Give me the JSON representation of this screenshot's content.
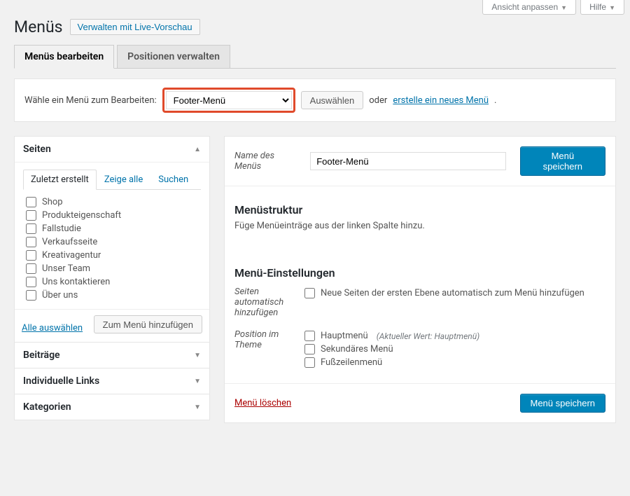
{
  "screen_meta": {
    "customize": "Ansicht anpassen",
    "help": "Hilfe"
  },
  "page_title": "Menüs",
  "live_preview_btn": "Verwalten mit Live-Vorschau",
  "tabs": {
    "edit": "Menüs bearbeiten",
    "locations": "Positionen verwalten"
  },
  "select_bar": {
    "label": "Wähle ein Menü zum Bearbeiten:",
    "selected": "Footer-Menü",
    "choose_btn": "Auswählen",
    "or_text": "oder ",
    "new_link": "erstelle ein neues Menü",
    "period": "."
  },
  "left": {
    "pages": {
      "title": "Seiten",
      "inner_tabs": {
        "recent": "Zuletzt erstellt",
        "all": "Zeige alle",
        "search": "Suchen"
      },
      "items": [
        "Shop",
        "Produkteigenschaft",
        "Fallstudie",
        "Verkaufsseite",
        "Kreativagentur",
        "Unser Team",
        "Uns kontaktieren",
        "Über uns"
      ],
      "select_all": "Alle auswählen",
      "add_btn": "Zum Menü hinzufügen"
    },
    "posts": "Beiträge",
    "links": "Individuelle Links",
    "cats": "Kategorien"
  },
  "right": {
    "name_label": "Name des Menüs",
    "name_value": "Footer-Menü",
    "save_btn": "Menü speichern",
    "structure_h": "Menüstruktur",
    "structure_hint": "Füge Menüeinträge aus der linken Spalte hinzu.",
    "settings_h": "Menü-Einstellungen",
    "auto_label": "Seiten automatisch hinzufügen",
    "auto_opt": "Neue Seiten der ersten Ebene automatisch zum Menü hinzufügen",
    "loc_label": "Position im Theme",
    "loc_main": "Hauptmenü",
    "loc_main_note": "(Aktueller Wert: Hauptmenü)",
    "loc_second": "Sekundäres Menü",
    "loc_footer": "Fußzeilenmenü",
    "delete": "Menü löschen"
  }
}
